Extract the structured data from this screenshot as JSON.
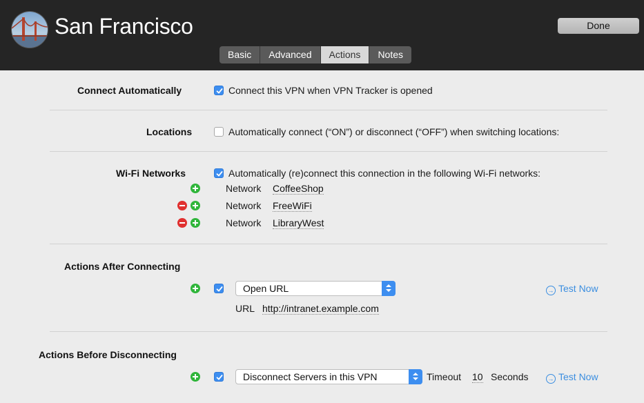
{
  "header": {
    "title": "San Francisco",
    "done_label": "Done",
    "avatar_icon": "golden-gate-photo-icon"
  },
  "tabs": [
    {
      "label": "Basic",
      "active": false
    },
    {
      "label": "Advanced",
      "active": false
    },
    {
      "label": "Actions",
      "active": true
    },
    {
      "label": "Notes",
      "active": false
    }
  ],
  "connect_automatically": {
    "label": "Connect Automatically",
    "checkbox_label": "Connect this VPN when VPN Tracker is opened",
    "checked": true
  },
  "locations": {
    "label": "Locations",
    "checkbox_label": "Automatically connect (“ON”) or disconnect (“OFF”) when switching locations:",
    "checked": false
  },
  "wifi": {
    "label": "Wi-Fi Networks",
    "checkbox_label": "Automatically (re)connect this connection in the following Wi-Fi networks:",
    "checked": true,
    "network_label": "Network",
    "networks": [
      "CoffeeShop",
      "FreeWiFi",
      "LibraryWest"
    ]
  },
  "after_connecting": {
    "label": "Actions After Connecting",
    "checked": true,
    "action": "Open URL",
    "url_label": "URL",
    "url_value": "http://intranet.example.com",
    "test_now": "Test Now"
  },
  "before_disconnecting": {
    "label": "Actions Before Disconnecting",
    "checked": true,
    "action": "Disconnect Servers in this VPN",
    "timeout_label": "Timeout",
    "timeout_value": "10",
    "seconds_label": "Seconds",
    "test_now": "Test Now"
  },
  "colors": {
    "header_bg": "#252525",
    "accent": "#3d8ef0",
    "add": "#2fb53a",
    "remove": "#e0302f",
    "link": "#3b8ee0"
  }
}
